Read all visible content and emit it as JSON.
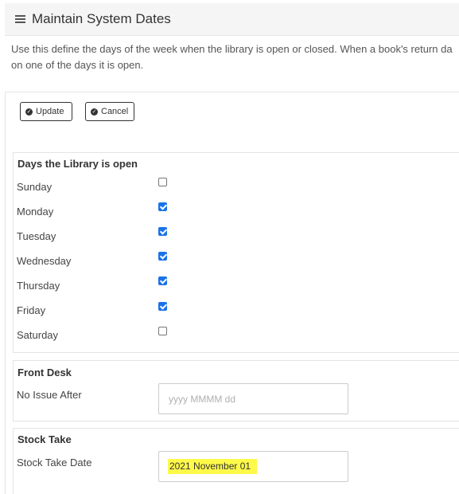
{
  "header": {
    "title": "Maintain System Dates",
    "icon": "list-icon"
  },
  "description": {
    "line1": "Use this define the days of the week when the library is open or closed. When a book's return da",
    "line2": "on one of the days it is open."
  },
  "toolbar": {
    "update_label": "Update",
    "cancel_label": "Cancel",
    "button_icon": "check-circle-icon"
  },
  "days_section": {
    "title": "Days the Library is open",
    "days": [
      {
        "label": "Sunday",
        "checked": false
      },
      {
        "label": "Monday",
        "checked": true
      },
      {
        "label": "Tuesday",
        "checked": true
      },
      {
        "label": "Wednesday",
        "checked": true
      },
      {
        "label": "Thursday",
        "checked": true
      },
      {
        "label": "Friday",
        "checked": true
      },
      {
        "label": "Saturday",
        "checked": false
      }
    ]
  },
  "front_desk": {
    "title": "Front Desk",
    "no_issue_label": "No Issue After",
    "no_issue_value": "",
    "no_issue_placeholder": "yyyy MMMM dd"
  },
  "stock_take": {
    "title": "Stock Take",
    "date_label": "Stock Take Date",
    "date_value": "2021 November 01",
    "highlight_color": "#fff94a"
  },
  "colors": {
    "checkbox_checked": "#1a73e8",
    "header_bg": "#f5f5f5"
  }
}
